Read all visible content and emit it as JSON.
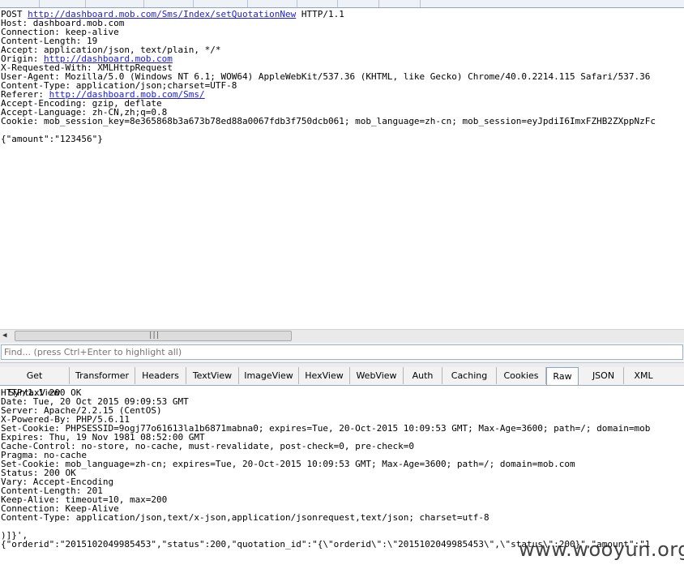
{
  "request": {
    "method": "POST",
    "url": "http://dashboard.mob.com/Sms/Index/setQuotationNew",
    "protocol": "HTTP/1.1",
    "headers": [
      "Host: dashboard.mob.com",
      "Connection: keep-alive",
      "Content-Length: 19",
      "Accept: application/json, text/plain, */*"
    ],
    "origin_key": "Origin: ",
    "origin_url": "http://dashboard.mob.com",
    "headers2": [
      "X-Requested-With: XMLHttpRequest",
      "User-Agent: Mozilla/5.0 (Windows NT 6.1; WOW64) AppleWebKit/537.36 (KHTML, like Gecko) Chrome/40.0.2214.115 Safari/537.36",
      "Content-Type: application/json;charset=UTF-8"
    ],
    "referer_key": "Referer: ",
    "referer_url": "http://dashboard.mob.com/Sms/",
    "headers3": [
      "Accept-Encoding: gzip, deflate",
      "Accept-Language: zh-CN,zh;q=0.8",
      "Cookie: mob_session_key=8e365868b3a673b78ed88a0067fdb3f750dcb061; mob_language=zh-cn; mob_session=eyJpdiI6ImxFZHB2ZXppNzFc"
    ],
    "body": "{\"amount\":\"123456\"}"
  },
  "find": {
    "placeholder": "Find... (press Ctrl+Enter to highlight all)"
  },
  "response_tabs": [
    {
      "label": "Get SyntaxView",
      "active": false
    },
    {
      "label": "Transformer",
      "active": false
    },
    {
      "label": "Headers",
      "active": false
    },
    {
      "label": "TextView",
      "active": false
    },
    {
      "label": "ImageView",
      "active": false
    },
    {
      "label": "HexView",
      "active": false
    },
    {
      "label": "WebView",
      "active": false
    },
    {
      "label": "Auth",
      "active": false
    },
    {
      "label": "Caching",
      "active": false
    },
    {
      "label": "Cookies",
      "active": false
    },
    {
      "label": "Raw",
      "active": true
    },
    {
      "label": "JSON",
      "active": false
    },
    {
      "label": "XML",
      "active": false
    }
  ],
  "response": {
    "lines": [
      "HTTP/1.1 200 OK",
      "Date: Tue, 20 Oct 2015 09:09:53 GMT",
      "Server: Apache/2.2.15 (CentOS)",
      "X-Powered-By: PHP/5.6.11",
      "Set-Cookie: PHPSESSID=9ogj77o61613la1b6871mabna0; expires=Tue, 20-Oct-2015 10:09:53 GMT; Max-Age=3600; path=/; domain=mob",
      "Expires: Thu, 19 Nov 1981 08:52:00 GMT",
      "Cache-Control: no-store, no-cache, must-revalidate, post-check=0, pre-check=0",
      "Pragma: no-cache",
      "Set-Cookie: mob_language=zh-cn; expires=Tue, 20-Oct-2015 10:09:53 GMT; Max-Age=3600; path=/; domain=mob.com",
      "Status: 200 OK",
      "Vary: Accept-Encoding",
      "Content-Length: 201",
      "Keep-Alive: timeout=10, max=200",
      "Connection: Keep-Alive",
      "Content-Type: application/json,text/x-json,application/jsonrequest,text/json; charset=utf-8"
    ],
    "body_line1": ")]}',",
    "body_line2": "{\"orderid\":\"2015102049985453\",\"status\":200,\"quotation_id\":\"{\\\"orderid\\\":\\\"2015102049985453\\\",\\\"status\\\":200}\",\"amount\":\"1"
  },
  "watermark": "www.wooyun.org",
  "colors": {
    "link": "#1a1aee",
    "tab_border": "#8fa3bf"
  }
}
